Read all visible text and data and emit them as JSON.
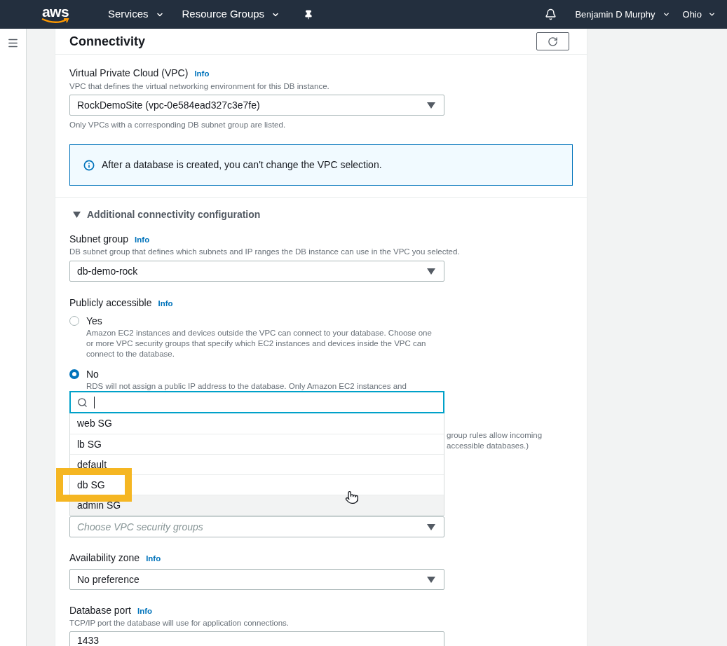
{
  "nav": {
    "logo": "aws",
    "menus": [
      {
        "label": "Services"
      },
      {
        "label": "Resource Groups"
      }
    ],
    "user": "Benjamin D Murphy",
    "region": "Ohio"
  },
  "section": {
    "title": "Connectivity"
  },
  "vpc": {
    "label": "Virtual Private Cloud (VPC)",
    "info": "Info",
    "description": "VPC that defines the virtual networking environment for this DB instance.",
    "value": "RockDemoSite (vpc-0e584ead327c3e7fe)",
    "hint": "Only VPCs with a corresponding DB subnet group are listed."
  },
  "alert": {
    "text": "After a database is created, you can't change the VPC selection."
  },
  "additional": {
    "title": "Additional connectivity configuration",
    "expanded": true
  },
  "subnet_group": {
    "label": "Subnet group",
    "info": "Info",
    "description": "DB subnet group that defines which subnets and IP ranges the DB instance can use in the VPC you selected.",
    "value": "db-demo-rock"
  },
  "public_access": {
    "label": "Publicly accessible",
    "info": "Info",
    "options": [
      {
        "label": "Yes",
        "description": "Amazon EC2 instances and devices outside the VPC can connect to your database. Choose one or more VPC security groups that specify which EC2 instances and devices inside the VPC can connect to the database.",
        "selected": false
      },
      {
        "label": "No",
        "description": "RDS will not assign a public IP address to the database. Only Amazon EC2 instances and",
        "selected": true
      }
    ]
  },
  "security_groups": {
    "covered_text": [
      "group rules allow incoming",
      "accessible databases.)"
    ],
    "open": true,
    "options": [
      {
        "label": "web SG",
        "hovered": false,
        "highlighted": false
      },
      {
        "label": "lb SG",
        "hovered": false,
        "highlighted": false
      },
      {
        "label": "default",
        "hovered": false,
        "highlighted": false
      },
      {
        "label": "db SG",
        "hovered": false,
        "highlighted": true
      },
      {
        "label": "admin SG",
        "hovered": true,
        "highlighted": false
      }
    ],
    "placeholder": "Choose VPC security groups"
  },
  "availability_zone": {
    "label": "Availability zone",
    "info": "Info",
    "value": "No preference"
  },
  "database_port": {
    "label": "Database port",
    "info": "Info",
    "description": "TCP/IP port the database will use for application connections.",
    "value": "1433"
  }
}
